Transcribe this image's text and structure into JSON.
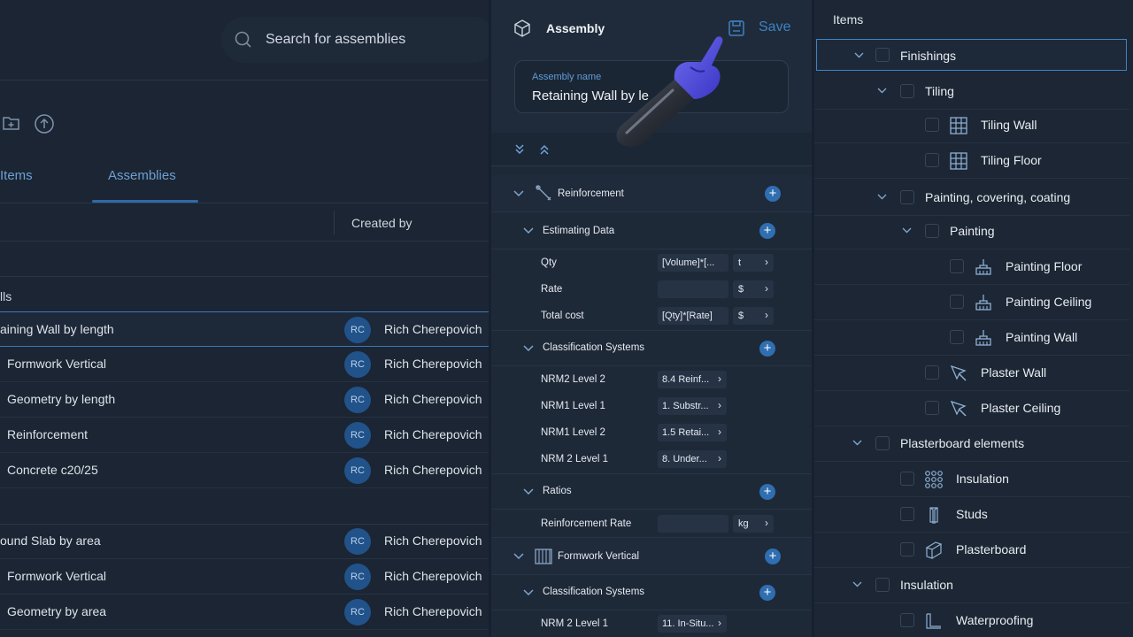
{
  "left": {
    "search_placeholder": "Search for assemblies",
    "tabs": [
      "Items",
      "Assemblies"
    ],
    "column_created_by": "Created by",
    "groups": [
      "lls"
    ],
    "rows": [
      {
        "name": "aining Wall by length",
        "initials": "RC",
        "creator": "Rich Cherepovich"
      },
      {
        "name": "Formwork Vertical",
        "initials": "RC",
        "creator": "Rich Cherepovich"
      },
      {
        "name": "Geometry by length",
        "initials": "RC",
        "creator": "Rich Cherepovich"
      },
      {
        "name": "Reinforcement",
        "initials": "RC",
        "creator": "Rich Cherepovich"
      },
      {
        "name": "Concrete c20/25",
        "initials": "RC",
        "creator": "Rich Cherepovich"
      },
      {
        "name": "ound Slab by area",
        "initials": "RC",
        "creator": "Rich Cherepovich"
      },
      {
        "name": "Formwork Vertical",
        "initials": "RC",
        "creator": "Rich Cherepovich"
      },
      {
        "name": "Geometry by area",
        "initials": "RC",
        "creator": "Rich Cherepovich"
      }
    ]
  },
  "middle": {
    "title": "Assembly",
    "save_label": "Save",
    "name_label": "Assembly name",
    "name_value": "Retaining Wall by le",
    "sections": {
      "reinforcement": "Reinforcement",
      "estimating": "Estimating Data",
      "classification": "Classification Systems",
      "ratios": "Ratios",
      "formwork": "Formwork Vertical",
      "classification2": "Classification Systems"
    },
    "estimating_rows": [
      {
        "label": "Qty",
        "value": "[Volume]*[...",
        "unit": "t"
      },
      {
        "label": "Rate",
        "value": "",
        "unit": "$"
      },
      {
        "label": "Total cost",
        "value": "[Qty]*[Rate]",
        "unit": "$"
      }
    ],
    "class_rows": [
      {
        "label": "NRM2 Level 2",
        "value": "8.4 Reinf..."
      },
      {
        "label": "NRM1 Level 1",
        "value": "1. Substr..."
      },
      {
        "label": "NRM1 Level 2",
        "value": "1.5 Retai..."
      },
      {
        "label": "NRM 2 Level 1",
        "value": "8. Under..."
      }
    ],
    "ratio_rows": [
      {
        "label": "Reinforcement Rate",
        "value": "",
        "unit": "kg"
      }
    ],
    "class2_rows": [
      {
        "label": "NRM 2 Level 1",
        "value": "11. In-Situ..."
      }
    ]
  },
  "right": {
    "title": "Items",
    "tree": [
      {
        "label": "Finishings",
        "icon": "chevron"
      },
      {
        "label": "Tiling",
        "icon": "chevron"
      },
      {
        "label": "Tiling Wall",
        "icon": "tile-icon"
      },
      {
        "label": "Tiling Floor",
        "icon": "tile-icon"
      },
      {
        "label": "Painting, covering, coating",
        "icon": "chevron"
      },
      {
        "label": "Painting",
        "icon": "chevron"
      },
      {
        "label": "Painting Floor",
        "icon": "brush-icon"
      },
      {
        "label": "Painting Ceiling",
        "icon": "brush-icon"
      },
      {
        "label": "Painting Wall",
        "icon": "brush-icon"
      },
      {
        "label": "Plaster Wall",
        "icon": "trowel-icon"
      },
      {
        "label": "Plaster Ceiling",
        "icon": "trowel-icon"
      },
      {
        "label": "Plasterboard elements",
        "icon": "chevron"
      },
      {
        "label": "Insulation",
        "icon": "grid-dots-icon"
      },
      {
        "label": "Studs",
        "icon": "stud-icon"
      },
      {
        "label": "Plasterboard",
        "icon": "board-icon"
      },
      {
        "label": "Insulation",
        "icon": "chevron"
      },
      {
        "label": "Waterproofing",
        "icon": "waterproof-icon"
      }
    ]
  }
}
